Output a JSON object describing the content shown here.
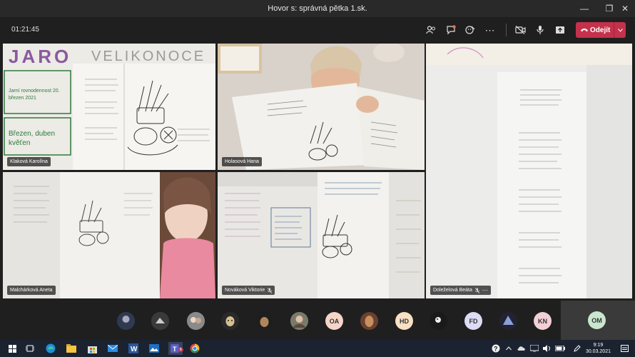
{
  "window": {
    "title": "Hovor s: správná pětka 1.sk."
  },
  "toolbar": {
    "timer": "01:21:45",
    "leave_label": "Odejít"
  },
  "participants": [
    {
      "name": "Klaková Karolína",
      "muted": false
    },
    {
      "name": "Holasová Hana",
      "muted": false
    },
    {
      "name": "Malchárková Aneta",
      "muted": false
    },
    {
      "name": "Nováková Viktorie",
      "muted": true
    },
    {
      "name": "Doleželová Beáta",
      "muted": true
    }
  ],
  "tile1": {
    "banner_left": "JARO",
    "banner_right": "VELIKONOCE",
    "card1": "Jarní rovnodennost 20. březen 2021",
    "card2": "Březen, duben kvěťen"
  },
  "gallery": {
    "initials": [
      "OA",
      "HD",
      "FD",
      "KN"
    ],
    "self_initials": "OM"
  },
  "taskbar": {
    "teams_badge": "6",
    "time": "9:19",
    "date": "30.03.2021"
  },
  "colors": {
    "leave_button": "#c4314b",
    "background": "#1f1f1f"
  }
}
